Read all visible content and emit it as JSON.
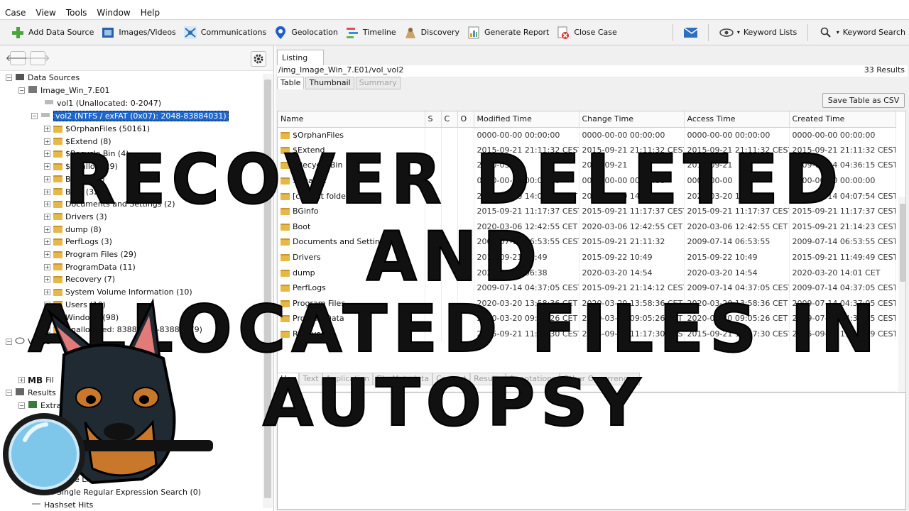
{
  "menu": [
    "Case",
    "View",
    "Tools",
    "Window",
    "Help"
  ],
  "toolbar": {
    "add_data_source": "Add Data Source",
    "images_videos": "Images/Videos",
    "communications": "Communications",
    "geolocation": "Geolocation",
    "timeline": "Timeline",
    "discovery": "Discovery",
    "generate_report": "Generate Report",
    "close_case": "Close Case",
    "keyword_lists": "Keyword Lists",
    "keyword_search": "Keyword Search"
  },
  "tree": {
    "data_sources": "Data Sources",
    "image": "Image_Win_7.E01",
    "vol1": "vol1 (Unallocated: 0-2047)",
    "vol2": "vol2 (NTFS / exFAT (0x07): 2048-83884031)",
    "items": [
      "$OrphanFiles (50161)",
      "$Extend (8)",
      "$Recycle.Bin (4)",
      "$Unalloc (29)",
      "BGinfo (5)",
      "Boot (32)",
      "Documents and Settings (2)",
      "Drivers (3)",
      "dump (8)",
      "PerfLogs (3)",
      "Program Files (29)",
      "ProgramData (11)",
      "Recovery (7)",
      "System Volume Information (10)",
      "Users (10)",
      "Windows (98)",
      "Unallocated: 83884032-83886079)"
    ],
    "views": "Views",
    "results": "Results",
    "extracted": "Extra",
    "single_literal": "ngle Literal",
    "single_regex": "Single Regular Expression Search (0)",
    "hashset_hits": "Hashset Hits",
    "mb_label": "MB",
    "fi_label": "Fil"
  },
  "listing": {
    "tab": "Listing",
    "path": "/img_Image_Win_7.E01/vol_vol2",
    "results": "33  Results",
    "subtabs": [
      "Table",
      "Thumbnail",
      "Summary"
    ],
    "save_csv": "Save Table as CSV",
    "columns": [
      "Name",
      "S",
      "C",
      "O",
      "Modified Time",
      "Change Time",
      "Access Time",
      "Created Time"
    ],
    "rows": [
      [
        "$OrphanFiles",
        "0000-00-00 00:00:00",
        "0000-00-00 00:00:00",
        "0000-00-00 00:00:00",
        "0000-00-00 00:00:00"
      ],
      [
        "$Extend",
        "2015-09-21 21:11:32 CEST",
        "2015-09-21 21:11:32 CEST",
        "2015-09-21 21:11:32 CEST",
        "2015-09-21 21:11:32 CEST"
      ],
      [
        "$Recycle.Bin",
        "2020-03-1",
        "2015-09-21",
        "2015-09-21",
        "2009-07-14 04:36:15 CEST"
      ],
      [
        "$Unalloc",
        "0000-00-00 00:00:00",
        "0000-00-00 00:00:00",
        "0000-00-00",
        "0000-00-00 00:00:00"
      ],
      [
        "[current folder]",
        "2020-03-20 14:01:21 CET",
        "2020-03-20 14:01:21",
        "2020-03-20 14:01:21",
        "2009-07-14 04:07:54 CEST"
      ],
      [
        "BGinfo",
        "2015-09-21 11:17:37 CEST",
        "2015-09-21 11:17:37 CEST",
        "2015-09-21 11:17:37 CEST",
        "2015-09-21 11:17:37 CEST"
      ],
      [
        "Boot",
        "2020-03-06 12:42:55 CET",
        "2020-03-06 12:42:55 CET",
        "2020-03-06 12:42:55 CET",
        "2015-09-21 21:14:23 CEST"
      ],
      [
        "Documents and Settings",
        "2009-07-14 06:53:55 CEST",
        "2015-09-21 21:11:32",
        "2009-07-14 06:53:55",
        "2009-07-14 06:53:55 CEST"
      ],
      [
        "Drivers",
        "2015-09-21 11:49",
        "2015-09-22 10:49",
        "2015-09-22 10:49",
        "2015-09-21 11:49:49 CEST"
      ],
      [
        "dump",
        "2020-03-20 06:38",
        "2020-03-20 14:54",
        "2020-03-20 14:54",
        "2020-03-20 14:01 CET"
      ],
      [
        "PerfLogs",
        "2009-07-14 04:37:05 CEST",
        "2015-09-21 21:14:12 CEST",
        "2009-07-14 04:37:05 CEST",
        "2009-07-14 04:37:05 CEST"
      ],
      [
        "Program Files",
        "2020-03-20 13:58:36 CET",
        "2020-03-20 13:58:36 CET",
        "2020-03-20 13:58:36 CET",
        "2009-07-14 04:37:05 CEST"
      ],
      [
        "ProgramData",
        "2020-03-20 09:05:26 CET",
        "2020-03-20 09:05:26 CET",
        "2020-03-20 09:05:26 CET",
        "2009-07-14 04:37:05 CEST"
      ],
      [
        "Recovery",
        "2015-09-21 11:17:30 CEST",
        "2015-09-21 11:17:30 CEST",
        "2015-09-21 11:17:30 CEST",
        "2015-09-21 11:17:29 CEST"
      ]
    ]
  },
  "viewer_tabs": [
    "Hex",
    "Text",
    "Application",
    "File Metadata",
    "Context",
    "Results",
    "Annotations",
    "Other Occurrences"
  ],
  "overlay": {
    "line1": "RECOVER DELETED AND",
    "line2": "ALLOCATED FILES IN AUTOPSY"
  },
  "colors": {
    "selection": "#1e66c9",
    "folder": "#e6b84a",
    "mascot_fur": "#1f2a33",
    "mascot_tan": "#c9772b"
  }
}
